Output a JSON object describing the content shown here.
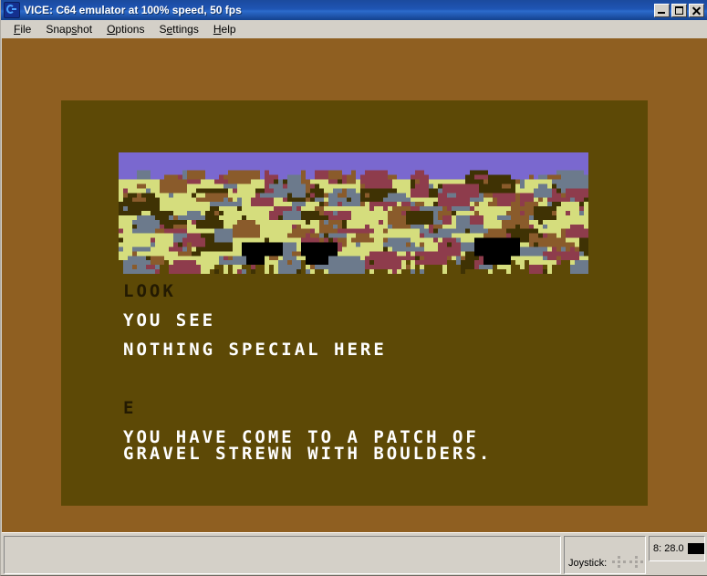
{
  "window": {
    "title": "VICE: C64 emulator at 100% speed, 50 fps",
    "icon": "commodore-logo-icon",
    "buttons": {
      "minimize": "minimize-icon",
      "maximize": "maximize-icon",
      "close": "close-icon"
    }
  },
  "menu": {
    "items": [
      {
        "label": "File",
        "accel": "F",
        "before": "",
        "after": "ile"
      },
      {
        "label": "Snapshot",
        "accel": "s",
        "before": "Snap",
        "after": "hot"
      },
      {
        "label": "Options",
        "accel": "O",
        "before": "",
        "after": "ptions"
      },
      {
        "label": "Settings",
        "accel": "e",
        "before": "S",
        "after": "ttings"
      },
      {
        "label": "Help",
        "accel": "H",
        "before": "",
        "after": "elp"
      }
    ]
  },
  "emulator": {
    "screen": {
      "border_color": "#8f5f21",
      "background_color": "#5d4906",
      "graphics": {
        "description": "pixelated landscape of gravel strewn with boulders",
        "sky_color": "#7a68cf",
        "gravel_color": "#d5dd7d",
        "boulder_colors": [
          "#8a5b2b",
          "#6c7a8c",
          "#8e3c4c",
          "#3f3204",
          "#000000"
        ]
      },
      "text_lines": [
        {
          "id": "look",
          "text": "LOOK",
          "color": "dark"
        },
        {
          "id": "yousee",
          "text": "YOU SEE",
          "color": "white"
        },
        {
          "id": "nothing",
          "text": "NOTHING SPECIAL HERE",
          "color": "white"
        },
        {
          "id": "e",
          "text": "E",
          "color": "dark"
        },
        {
          "id": "desc1",
          "text": "YOU HAVE COME TO A PATCH OF",
          "color": "white"
        },
        {
          "id": "desc2",
          "text": "GRAVEL STREWN WITH BOULDERS.",
          "color": "white"
        }
      ]
    }
  },
  "status_bar": {
    "message": "",
    "joystick_label": "Joystick:",
    "joystick_ports": 2,
    "drive": {
      "text": "8: 28.0",
      "led_color": "#000000"
    }
  }
}
